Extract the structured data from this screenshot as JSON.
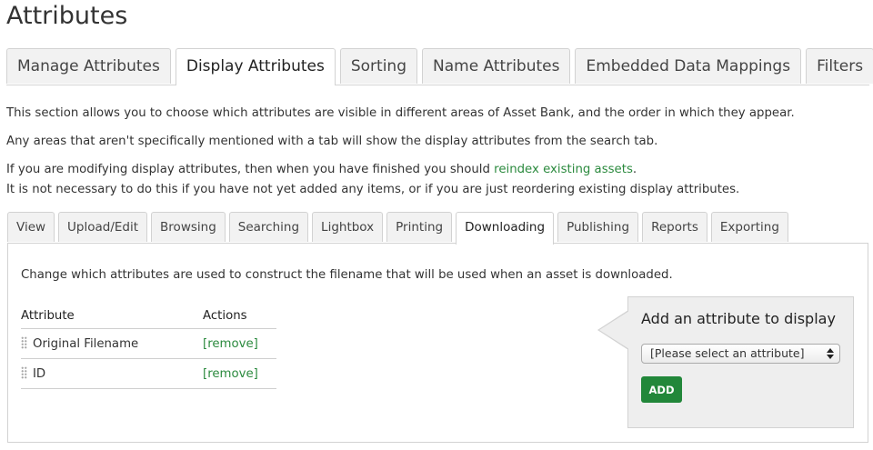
{
  "page_title": "Attributes",
  "main_tabs": [
    {
      "label": "Manage Attributes"
    },
    {
      "label": "Display Attributes"
    },
    {
      "label": "Sorting"
    },
    {
      "label": "Name Attributes"
    },
    {
      "label": "Embedded Data Mappings"
    },
    {
      "label": "Filters"
    }
  ],
  "active_main_tab": "Display Attributes",
  "intro": {
    "line1": "This section allows you to choose which attributes are visible in different areas of Asset Bank, and the order in which they appear.",
    "line2": "Any areas that aren't specifically mentioned with a tab will show the display attributes from the search tab.",
    "line3_prefix": "If you are modifying display attributes, then when you have finished you should ",
    "reindex_link": "reindex existing assets",
    "line3_suffix": ".",
    "line4": "It is not necessary to do this if you have not yet added any items, or if you are just reordering existing display attributes."
  },
  "sub_tabs": [
    {
      "label": "View"
    },
    {
      "label": "Upload/Edit"
    },
    {
      "label": "Browsing"
    },
    {
      "label": "Searching"
    },
    {
      "label": "Lightbox"
    },
    {
      "label": "Printing"
    },
    {
      "label": "Downloading"
    },
    {
      "label": "Publishing"
    },
    {
      "label": "Reports"
    },
    {
      "label": "Exporting"
    }
  ],
  "active_sub_tab": "Downloading",
  "panel": {
    "description": "Change which attributes are used to construct the filename that will be used when an asset is downloaded.",
    "table": {
      "headers": {
        "attribute": "Attribute",
        "actions": "Actions"
      },
      "rows": [
        {
          "name": "Original Filename",
          "action": "[remove]"
        },
        {
          "name": "ID",
          "action": "[remove]"
        }
      ]
    }
  },
  "add_box": {
    "title": "Add an attribute to display",
    "select_value": "[Please select an attribute]",
    "button_label": "ADD"
  },
  "colors": {
    "link_green": "#2b8a3e",
    "button_green": "#22873a",
    "tab_bg": "#f2f2f2",
    "box_bg": "#eeeeee"
  }
}
